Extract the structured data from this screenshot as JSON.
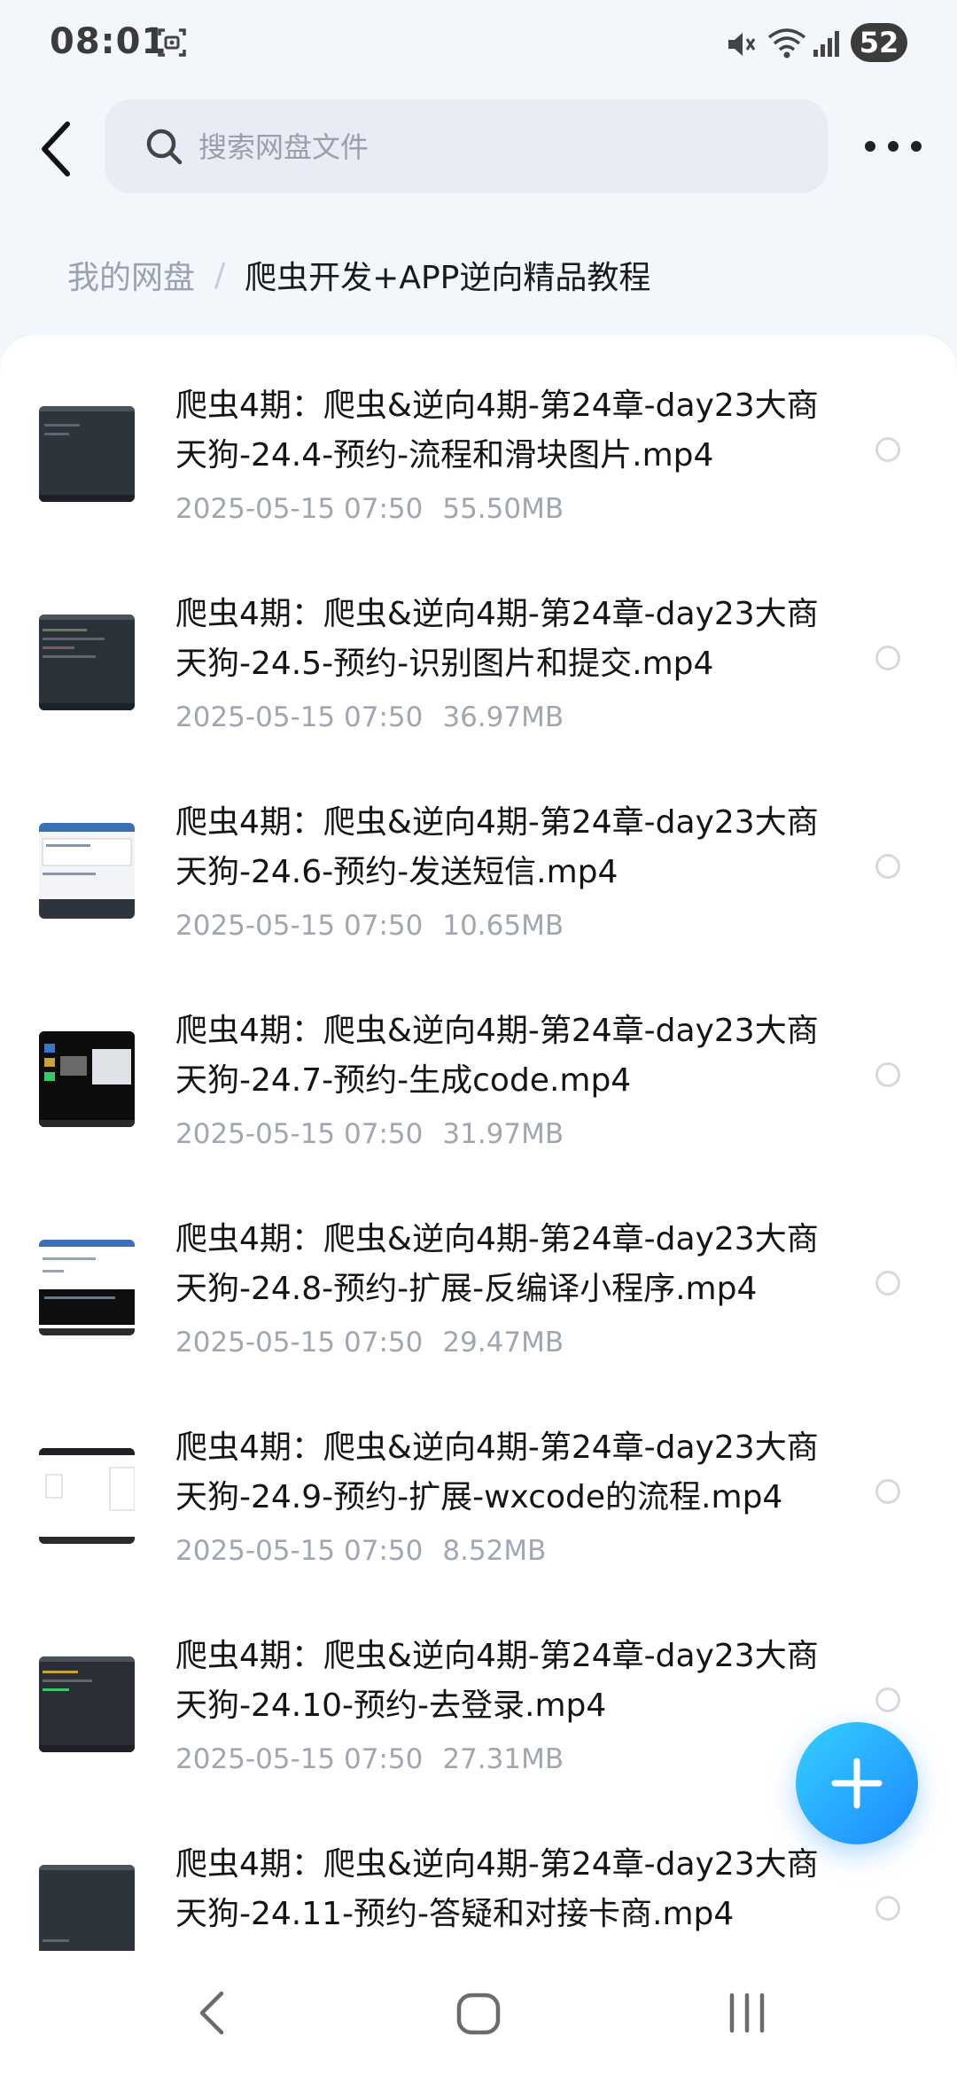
{
  "status_bar": {
    "time": "08:01",
    "battery": "52",
    "icons": [
      "screenshot-icon",
      "mute-icon",
      "wifi-icon",
      "signal-icon",
      "battery-icon"
    ]
  },
  "header": {
    "search_placeholder": "搜索网盘文件",
    "icons": [
      "back-arrow-icon",
      "search-icon",
      "more-icon"
    ]
  },
  "breadcrumb": {
    "root": "我的网盘",
    "separator": "/",
    "current": "爬虫开发+APP逆向精品教程"
  },
  "files": [
    {
      "name": "爬虫4期：爬虫&逆向4期-第24章-day23大商天狗-24.4-预约-流程和滑块图片.mp4",
      "date": "2025-05-15  07:50",
      "size": "55.50MB",
      "thumb_style": "dark"
    },
    {
      "name": "爬虫4期：爬虫&逆向4期-第24章-day23大商天狗-24.5-预约-识别图片和提交.mp4",
      "date": "2025-05-15  07:50",
      "size": "36.97MB",
      "thumb_style": "dark"
    },
    {
      "name": "爬虫4期：爬虫&逆向4期-第24章-day23大商天狗-24.6-预约-发送短信.mp4",
      "date": "2025-05-15  07:50",
      "size": "10.65MB",
      "thumb_style": "light"
    },
    {
      "name": "爬虫4期：爬虫&逆向4期-第24章-day23大商天狗-24.7-预约-生成code.mp4",
      "date": "2025-05-15  07:50",
      "size": "31.97MB",
      "thumb_style": "dark"
    },
    {
      "name": "爬虫4期：爬虫&逆向4期-第24章-day23大商天狗-24.8-预约-扩展-反编译小程序.mp4",
      "date": "2025-05-15  07:50",
      "size": "29.47MB",
      "thumb_style": "light"
    },
    {
      "name": "爬虫4期：爬虫&逆向4期-第24章-day23大商天狗-24.9-预约-扩展-wxcode的流程.mp4",
      "date": "2025-05-15  07:50",
      "size": "8.52MB",
      "thumb_style": "light"
    },
    {
      "name": "爬虫4期：爬虫&逆向4期-第24章-day23大商天狗-24.10-预约-去登录.mp4",
      "date": "2025-05-15  07:50",
      "size": "27.31MB",
      "thumb_style": "dark"
    },
    {
      "name": "爬虫4期：爬虫&逆向4期-第24章-day23大商天狗-24.11-预约-答疑和对接卡商.mp4",
      "date": "",
      "size": "",
      "thumb_style": "dark"
    }
  ],
  "fab": {
    "icon": "plus-icon"
  },
  "nav_bar": {
    "icons": [
      "nav-back-icon",
      "nav-home-icon",
      "nav-recents-icon"
    ]
  }
}
